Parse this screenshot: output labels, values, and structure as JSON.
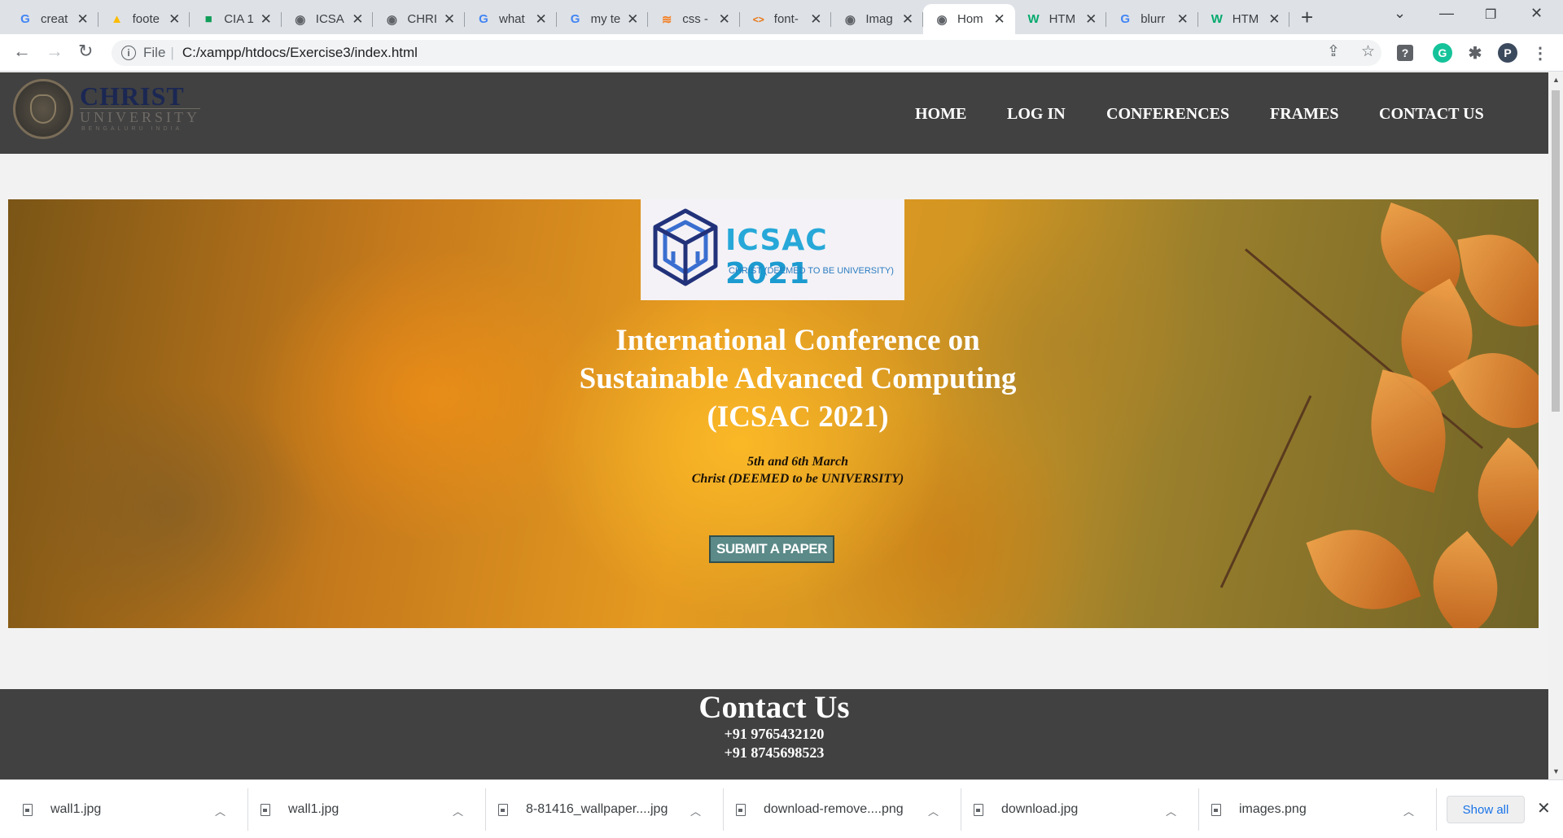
{
  "browser": {
    "tabs": [
      {
        "title": "creat",
        "icon": "google-g"
      },
      {
        "title": "foote",
        "icon": "google-drive"
      },
      {
        "title": "CIA 1",
        "icon": "classroom"
      },
      {
        "title": "ICSA",
        "icon": "globe"
      },
      {
        "title": "CHRI",
        "icon": "globe"
      },
      {
        "title": "what",
        "icon": "google-g"
      },
      {
        "title": "my te",
        "icon": "google-g"
      },
      {
        "title": "css -",
        "icon": "stackoverflow"
      },
      {
        "title": "font-",
        "icon": "code"
      },
      {
        "title": "Imag",
        "icon": "globe"
      },
      {
        "title": "Hom",
        "icon": "globe",
        "active": true
      },
      {
        "title": "HTM",
        "icon": "w3schools"
      },
      {
        "title": "blurr",
        "icon": "google-g"
      },
      {
        "title": "HTM",
        "icon": "w3schools"
      }
    ],
    "new_tab": "+",
    "address": {
      "scheme_label": "File",
      "url": "C:/xampp/htdocs/Exercise3/index.html"
    },
    "profile_initial": "P",
    "colors": {
      "tabstrip": "#dee1e6",
      "google_blue": "#4285f4",
      "w3_green": "#04aa6d",
      "grammarly": "#15c39a"
    }
  },
  "site": {
    "logo": {
      "name": "CHRIST",
      "subtitle": "UNIVERSITY",
      "tagline": "BENGALURU INDIA"
    },
    "nav": [
      "HOME",
      "LOG IN",
      "CONFERENCES",
      "FRAMES",
      "CONTACT US"
    ],
    "hero": {
      "conference_logo": {
        "brand": "ICSAC",
        "year": "2021",
        "subtitle": "CHRIST (DEEMED TO BE UNIVERSITY)"
      },
      "title_lines": [
        "International Conference on",
        "Sustainable Advanced Computing",
        "(ICSAC 2021)"
      ],
      "dates": "5th and 6th March",
      "venue": "Christ (DEEMED to be UNIVERSITY)",
      "cta": "SUBMIT A PAPER"
    },
    "contact": {
      "heading": "Contact Us",
      "phones": [
        "+91 9765432120",
        "+91 8745698523"
      ]
    },
    "colors": {
      "header_bg": "#414141",
      "cta_bg": "#5b8a88",
      "page_bg": "#f2f2f2"
    }
  },
  "downloads": {
    "items": [
      "wall1.jpg",
      "wall1.jpg",
      "8-81416_wallpaper....jpg",
      "download-remove....png",
      "download.jpg",
      "images.png"
    ],
    "show_all": "Show all"
  }
}
